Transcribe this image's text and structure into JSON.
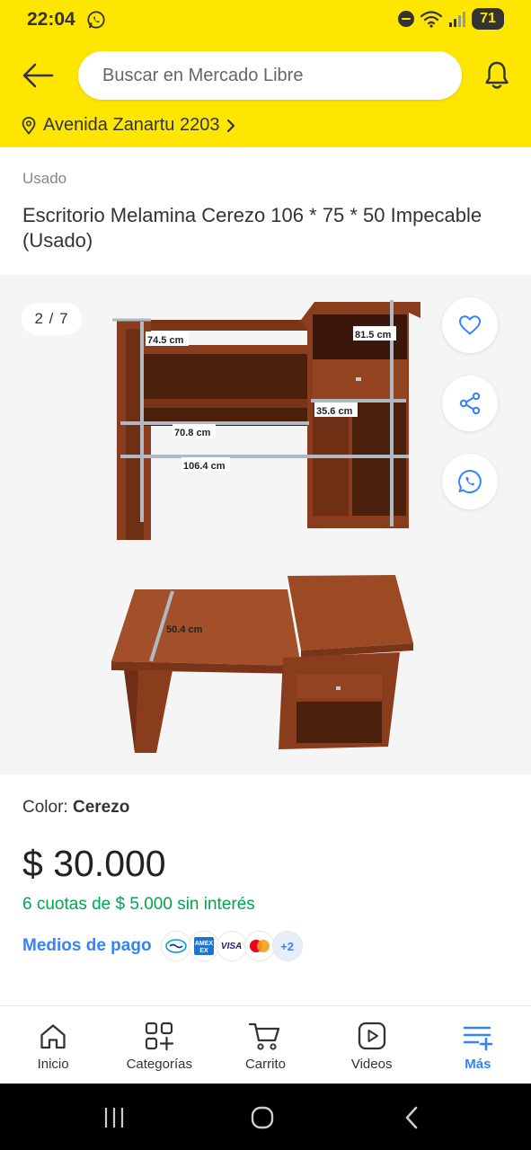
{
  "status_bar": {
    "time": "22:04",
    "battery": "71"
  },
  "header": {
    "search_placeholder": "Buscar en Mercado Libre",
    "address": "Avenida Zanartu 2203"
  },
  "product": {
    "condition": "Usado",
    "title": "Escritorio Melamina Cerezo 106 * 75 * 50 Impecable (Usado)",
    "image_counter": "2 / 7",
    "photo_dimensions": [
      "74.5 cm",
      "81.5 cm",
      "35.6 cm",
      "70.8 cm",
      "106.4 cm",
      "50.4 cm"
    ],
    "color_label": "Color: ",
    "color_value": "Cerezo",
    "price": "$ 30.000",
    "installments": "6 cuotas de $ 5.000 sin interés",
    "payment_link": "Medios de pago",
    "payment_methods": [
      "Mercado Pago",
      "AMEX",
      "VISA",
      "Mastercard"
    ],
    "payment_more": "+2"
  },
  "bottom_nav": [
    {
      "label": "Inicio",
      "icon": "home-icon"
    },
    {
      "label": "Categorías",
      "icon": "categories-icon"
    },
    {
      "label": "Carrito",
      "icon": "cart-icon"
    },
    {
      "label": "Videos",
      "icon": "video-icon"
    },
    {
      "label": "Más",
      "icon": "more-menu-icon"
    }
  ],
  "colors": {
    "brand_yellow": "#ffe600",
    "link_blue": "#3483fa",
    "success_green": "#00a650",
    "gallery_bg": "#f5f5f5"
  }
}
